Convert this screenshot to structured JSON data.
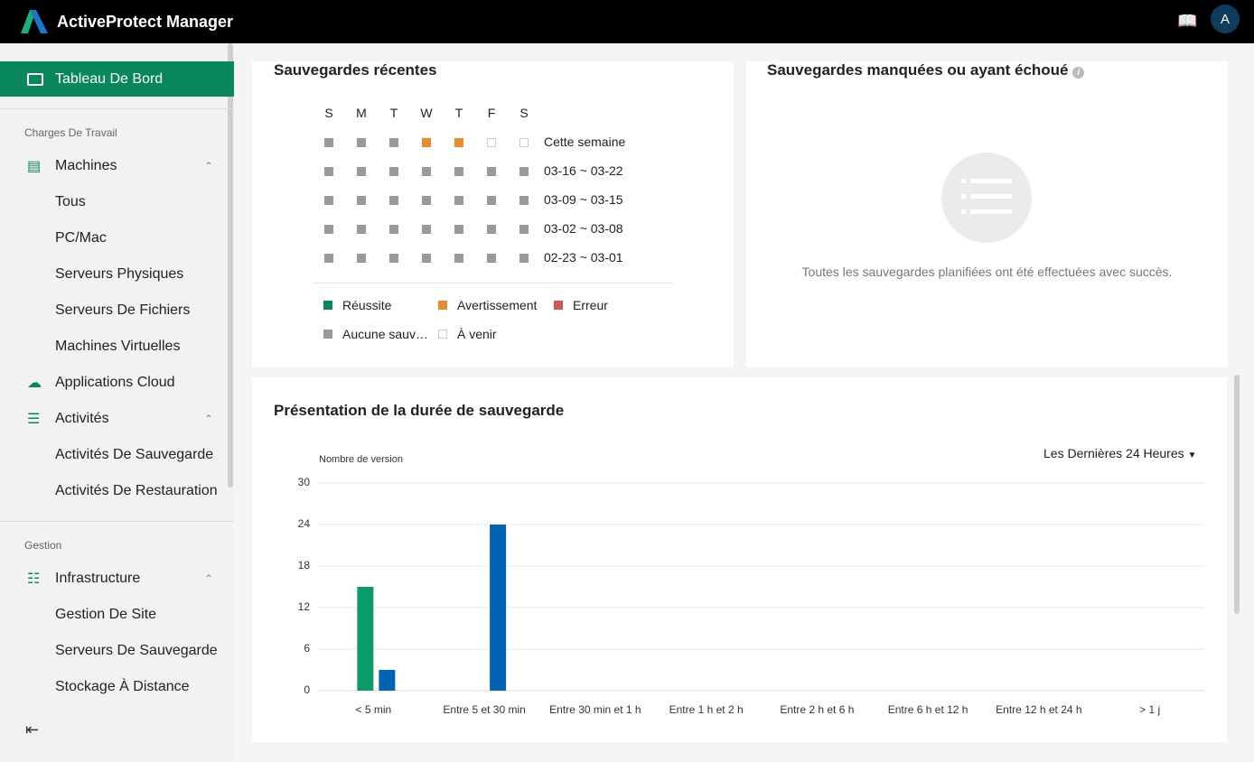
{
  "header": {
    "title": "ActiveProtect Manager",
    "avatar_letter": "A"
  },
  "sidebar": {
    "active": "Tableau De Bord",
    "section1": "Charges De Travail",
    "machines": "Machines",
    "machines_sub": [
      "Tous",
      "PC/Mac",
      "Serveurs Physiques",
      "Serveurs De Fichiers",
      "Machines Virtuelles"
    ],
    "cloud": "Applications Cloud",
    "activities": "Activités",
    "activities_sub": [
      "Activités De Sauvegarde",
      "Activités De Restauration"
    ],
    "section2": "Gestion",
    "infra": "Infrastructure",
    "infra_sub": [
      "Gestion De Site",
      "Serveurs De Sauvegarde",
      "Stockage À Distance"
    ]
  },
  "recent": {
    "title": "Sauvegardes récentes",
    "days": [
      "S",
      "M",
      "T",
      "W",
      "T",
      "F",
      "S"
    ],
    "weeks": [
      {
        "label": "Cette semaine",
        "status": [
          "none",
          "none",
          "none",
          "warning",
          "warning",
          "upcoming",
          "upcoming"
        ]
      },
      {
        "label": "03-16 ~ 03-22",
        "status": [
          "none",
          "none",
          "none",
          "none",
          "none",
          "none",
          "none"
        ]
      },
      {
        "label": "03-09 ~ 03-15",
        "status": [
          "none",
          "none",
          "none",
          "none",
          "none",
          "none",
          "none"
        ]
      },
      {
        "label": "03-02 ~ 03-08",
        "status": [
          "none",
          "none",
          "none",
          "none",
          "none",
          "none",
          "none"
        ]
      },
      {
        "label": "02-23 ~ 03-01",
        "status": [
          "none",
          "none",
          "none",
          "none",
          "none",
          "none",
          "none"
        ]
      }
    ],
    "legend": {
      "success": "Réussite",
      "warning": "Avertissement",
      "error": "Erreur",
      "none": "Aucune sauv…",
      "upcoming": "À venir"
    },
    "colors": {
      "success": "#07875a",
      "warning": "#ee8a2e",
      "error": "#d9534f",
      "none": "#999999",
      "upcoming": "#ffffff"
    }
  },
  "missed": {
    "title": "Sauvegardes manquées ou ayant échoué",
    "message": "Toutes les sauvegardes planifiées ont été effectuées avec succès."
  },
  "duration": {
    "title": "Présentation de la durée de sauvegarde",
    "range": "Les Dernières 24 Heures"
  },
  "chart_data": {
    "type": "bar",
    "ylabel": "Nombre de version",
    "ylim": [
      0,
      30
    ],
    "yticks": [
      0,
      6,
      12,
      18,
      24,
      30
    ],
    "categories": [
      "< 5 min",
      "Entre 5 et 30 min",
      "Entre 30 min et 1 h",
      "Entre 1 h et 2 h",
      "Entre 2 h et 6 h",
      "Entre 6 h et 12 h",
      "Entre 12 h et 24 h",
      "> 1 j"
    ],
    "series": [
      {
        "color": "#0a9a6c",
        "values": [
          15,
          0,
          0,
          0,
          0,
          0,
          0,
          0
        ]
      },
      {
        "color": "#0262b3",
        "values": [
          3,
          24,
          0,
          0,
          0,
          0,
          0,
          0
        ]
      }
    ],
    "grid": true
  }
}
